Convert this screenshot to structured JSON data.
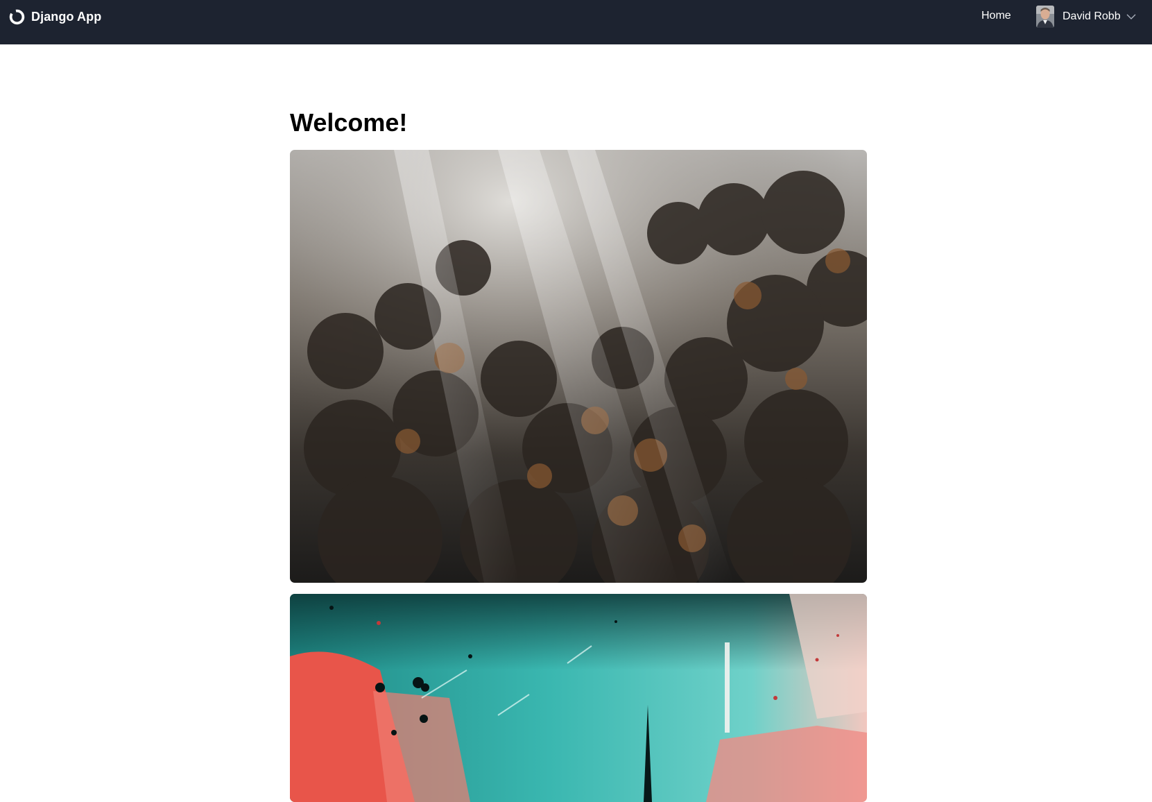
{
  "navbar": {
    "brand": {
      "name": "Django App",
      "icon": "circle-logo-icon"
    },
    "links": {
      "home": "Home"
    },
    "user": {
      "name": "David Robb",
      "avatar_icon": "user-avatar",
      "menu_icon": "chevron-down-icon"
    },
    "colors": {
      "background": "#1d2330",
      "text": "#ffffff"
    }
  },
  "main": {
    "title": "Welcome!",
    "images": [
      {
        "name": "misty-forest-aerial-photo"
      },
      {
        "name": "teal-red-abstract-paint-photo"
      }
    ]
  }
}
